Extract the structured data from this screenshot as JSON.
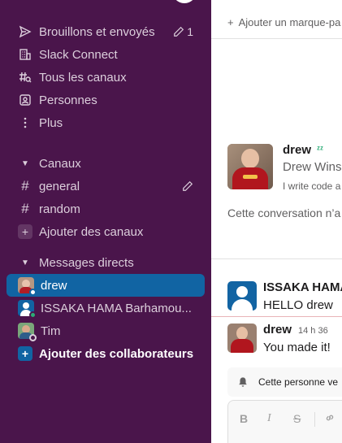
{
  "sidebar": {
    "nav": [
      {
        "label": "Brouillons et envoyés",
        "icon": "send-icon",
        "count": "1"
      },
      {
        "label": "Slack Connect",
        "icon": "building-icon"
      },
      {
        "label": "Tous les canaux",
        "icon": "channel-search-icon"
      },
      {
        "label": "Personnes",
        "icon": "people-icon"
      },
      {
        "label": "Plus",
        "icon": "more-vertical-icon"
      }
    ],
    "channels_header": "Canaux",
    "channels": [
      {
        "label": "general"
      },
      {
        "label": "random"
      }
    ],
    "add_channels": "Ajouter des canaux",
    "dm_header": "Messages directs",
    "dms": [
      {
        "label": "drew",
        "active": true
      },
      {
        "label": "ISSAKA HAMA Barhamou..."
      },
      {
        "label": "Tim"
      }
    ],
    "add_collaborators": "Ajouter des collaborateurs",
    "colors": {
      "background": "#4a154b",
      "active": "#1164a3",
      "text": "#dccfdc"
    }
  },
  "main": {
    "bookmark": {
      "plus": "+",
      "label": "Ajouter un marque-pa"
    },
    "profile": {
      "name": "drew",
      "full_name": "Drew Wins",
      "bio": "I write code a"
    },
    "conversation_text": "Cette conversation n’a",
    "messages": [
      {
        "author": "ISSAKA HAMA",
        "text": "HELLO drew"
      },
      {
        "author": "drew",
        "time": "14 h 36",
        "text": "You made it!"
      }
    ],
    "notice": "Cette personne ve",
    "composer": {
      "bold": "B",
      "italic": "I",
      "strike": "S"
    }
  }
}
